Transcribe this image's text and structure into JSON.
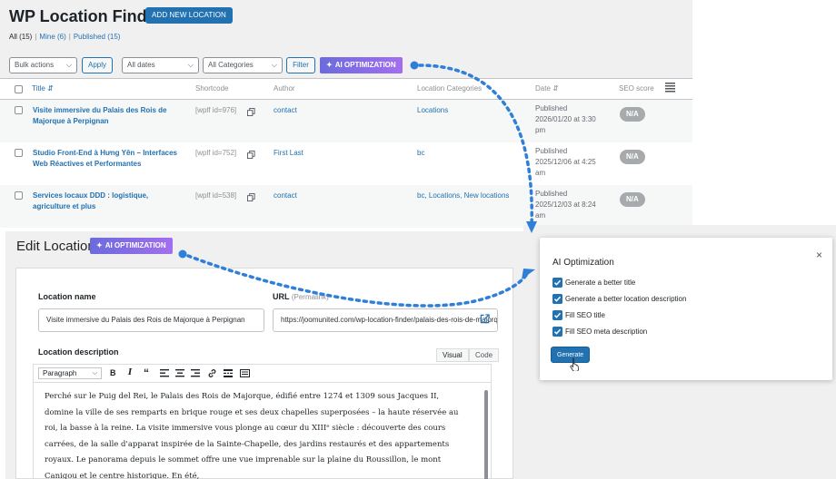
{
  "list": {
    "title": "WP Location Finder",
    "add_new": "ADD NEW LOCATION",
    "filters": {
      "all": "All (15)",
      "mine": "Mine (6)",
      "published": "Published (15)",
      "separator": "|"
    },
    "bulk_actions": "Bulk actions",
    "apply": "Apply",
    "all_dates": "All dates",
    "all_categories": "All Categories",
    "filter": "Filter",
    "ai_optimization": "AI OPTIMIZATION",
    "columns": {
      "title": "Title",
      "shortcode": "Shortcode",
      "author": "Author",
      "categories": "Location Categories",
      "date": "Date",
      "seo": "SEO score"
    },
    "rows": [
      {
        "title": "Visite immersive du Palais des Rois de Majorque à Perpignan",
        "shortcode": "[wplf id=976]",
        "author": "contact",
        "categories": "Locations",
        "status": "Published",
        "date": "2026/01/20 at 3:30 pm",
        "seo": "N/A"
      },
      {
        "title": "Studio Front-End à Hưng Yên – Interfaces Web Réactives et Performantes",
        "shortcode": "[wplf id=752]",
        "author": "First Last",
        "categories": "bc",
        "status": "Published",
        "date": "2025/12/06 at 4:25 am",
        "seo": "N/A"
      },
      {
        "title": "Services locaux DDD : logistique, agriculture et plus",
        "shortcode": "[wplf id=538]",
        "author": "contact",
        "categories": "bc, Locations, New locations",
        "status": "Published",
        "date": "2025/12/03 at 8:24 am",
        "seo": "N/A"
      }
    ]
  },
  "edit": {
    "title": "Edit Location",
    "ai_optimization": "AI OPTIMIZATION",
    "name_label": "Location name",
    "name_value": "Visite immersive du Palais des Rois de Majorque à Perpignan",
    "url_label": "URL",
    "url_hint": "(Permalink)",
    "url_value": "https://joomunited.com/wp-location-finder/palais-des-rois-de-majorque",
    "desc_label": "Location description",
    "tab_visual": "Visual",
    "tab_code": "Code",
    "format": "Paragraph",
    "description": "Perché sur le Puig del Rei, le Palais des Rois de Majorque, édifié entre 1274 et 1309 sous Jacques II, domine la ville de ses remparts en brique rouge et ses deux chapelles superposées – la haute réservée au roi, la basse à la reine. La visite immersive vous plonge au cœur du XIIIᵉ siècle : découverte des cours carrées, de la salle d'apparat inspirée de la Sainte-Chapelle, des jardins restaurés et des appartements royaux. Le panorama depuis le sommet offre une vue imprenable sur la plaine du Roussillon, le mont Canigou et le centre historique. En été,"
  },
  "modal": {
    "title": "AI Optimization",
    "close": "×",
    "options": [
      "Generate a better title",
      "Generate a better location description",
      "Fill SEO title",
      "Fill SEO meta description"
    ],
    "generate": "Generate"
  },
  "colors": {
    "accent": "#2271b1",
    "ai_gradient_start": "#6b6bdc",
    "ai_gradient_end": "#a36ef0",
    "badge": "#a7aaad"
  }
}
